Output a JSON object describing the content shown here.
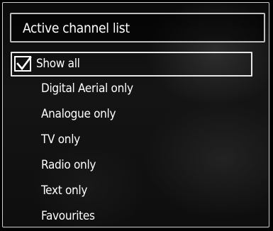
{
  "dialog": {
    "title": "Active channel list"
  },
  "menu": {
    "selected_index": 0,
    "items": [
      {
        "label": "Show all",
        "checked": true
      },
      {
        "label": "Digital Aerial only",
        "checked": false
      },
      {
        "label": "Analogue only",
        "checked": false
      },
      {
        "label": "TV only",
        "checked": false
      },
      {
        "label": "Radio only",
        "checked": false
      },
      {
        "label": "Text only",
        "checked": false
      },
      {
        "label": "Favourites",
        "checked": false
      }
    ]
  },
  "icons": {
    "check": "checkmark-icon"
  },
  "colors": {
    "background": "#000000",
    "text": "#ffffff",
    "border": "#cfcfcf",
    "highlight_border": "#e6e6e6"
  }
}
